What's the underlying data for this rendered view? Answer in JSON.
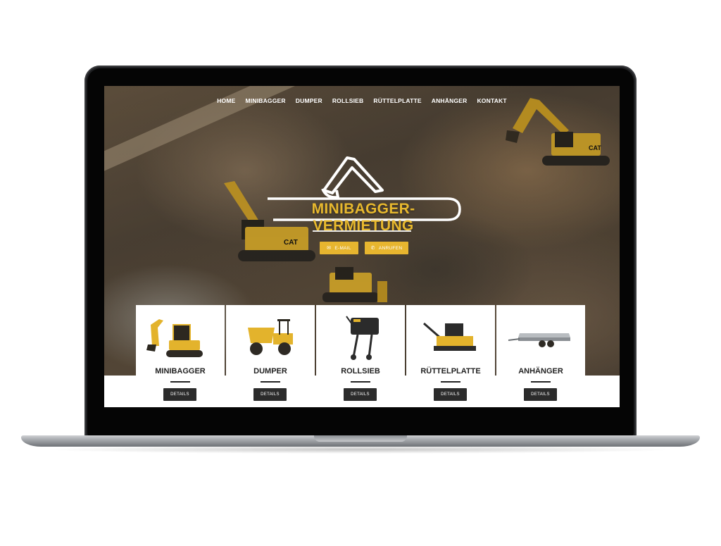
{
  "nav": {
    "items": [
      {
        "label": "HOME"
      },
      {
        "label": "MINIBAGGER"
      },
      {
        "label": "DUMPER"
      },
      {
        "label": "ROLLSIEB"
      },
      {
        "label": "RÜTTELPLATTE"
      },
      {
        "label": "ANHÄNGER"
      },
      {
        "label": "KONTAKT"
      }
    ]
  },
  "hero": {
    "logo_text": "MINIBAGGER-VERMIETUNG",
    "logo_icon": "excavator-arm-icon",
    "buttons": {
      "email": {
        "label": "E-MAIL",
        "icon": "envelope-icon"
      },
      "call": {
        "label": "ANRUFEN",
        "icon": "phone-icon"
      }
    }
  },
  "cards": [
    {
      "title": "MINIBAGGER",
      "button": "DETAILS",
      "image": "mini-excavator"
    },
    {
      "title": "DUMPER",
      "button": "DETAILS",
      "image": "dumper"
    },
    {
      "title": "ROLLSIEB",
      "button": "DETAILS",
      "image": "rolling-sieve"
    },
    {
      "title": "RÜTTELPLATTE",
      "button": "DETAILS",
      "image": "plate-compactor"
    },
    {
      "title": "ANHÄNGER",
      "button": "DETAILS",
      "image": "trailer"
    }
  ],
  "colors": {
    "accent": "#e7b52f",
    "button_dark": "#2b2b2b",
    "laptop_frame": "#1e1f21"
  }
}
